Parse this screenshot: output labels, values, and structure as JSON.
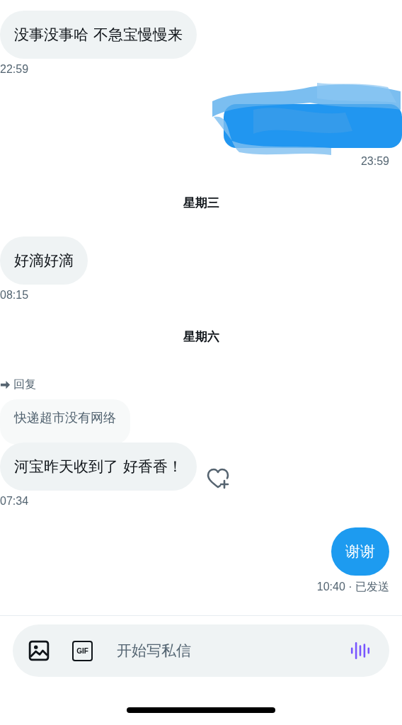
{
  "messages": [
    {
      "kind": "in",
      "text": "没事没事哈 不急宝慢慢来",
      "time": "22:59"
    },
    {
      "kind": "redacted",
      "time": "23:59"
    },
    {
      "kind": "day",
      "text": "星期三"
    },
    {
      "kind": "in",
      "text": "好滴好滴",
      "time": "08:15"
    },
    {
      "kind": "day",
      "text": "星期六"
    },
    {
      "kind": "reply",
      "reply_label": "回复",
      "quoted": "快递超市没有网络",
      "text": "河宝昨天收到了  好香香！",
      "time": "07:34"
    },
    {
      "kind": "out",
      "text": "谢谢",
      "time": "10:40 · 已发送"
    }
  ],
  "composer": {
    "gif_label": "GIF",
    "placeholder": "开始写私信"
  }
}
